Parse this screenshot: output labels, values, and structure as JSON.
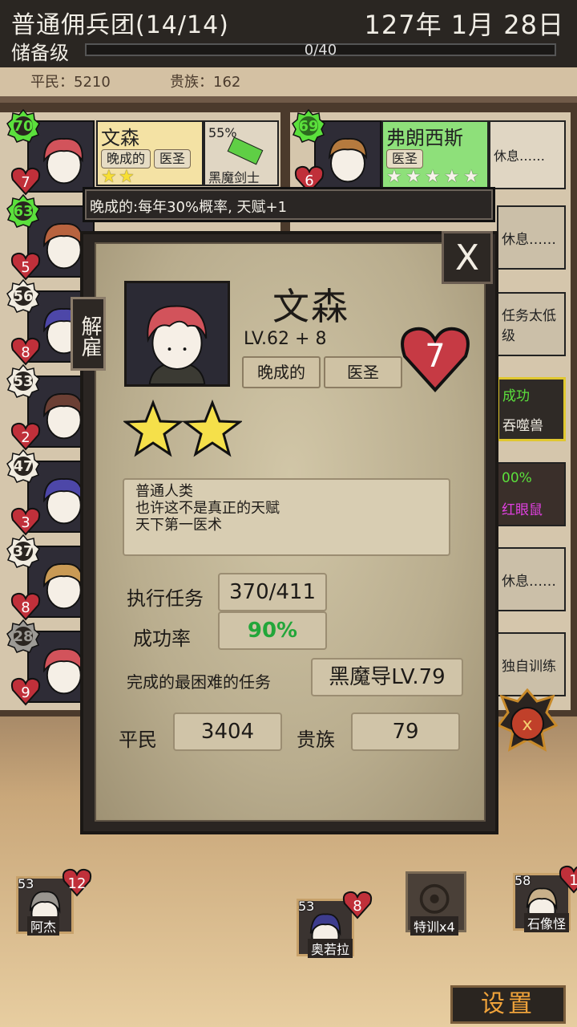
{
  "header": {
    "guild_name": "普通佣兵团(14/14)",
    "date": "127年 1月 28日",
    "rank": "储备级",
    "rep_text": "0/40",
    "rep_progress": 0
  },
  "counts": {
    "commoners": "平民：5210",
    "nobles": "贵族：162"
  },
  "mercs": [
    {
      "level": "70",
      "hearts": "7",
      "name": "文森",
      "tags": [
        "晚成的",
        "医圣"
      ],
      "stars": 2,
      "task_pct": "55%",
      "task_name": "黑魔剑士",
      "badge_color": "#5be03c"
    },
    {
      "level": "63",
      "hearts": "5",
      "badge_color": "#5be03c"
    },
    {
      "level": "56",
      "hearts": "8",
      "badge_color": "#f1ece0"
    },
    {
      "level": "53",
      "hearts": "2",
      "badge_color": "#f1ece0"
    },
    {
      "level": "47",
      "hearts": "3",
      "badge_color": "#f1ece0"
    },
    {
      "level": "37",
      "hearts": "8",
      "badge_color": "#f1ece0"
    },
    {
      "level": "28",
      "hearts": "9",
      "badge_color": "#9c9a95"
    }
  ],
  "right_merc": {
    "level": "69",
    "hearts": "6",
    "name": "弗朗西斯",
    "tag": "医圣",
    "stars": 5,
    "status": "休息……"
  },
  "right_slots": [
    "休息……",
    "任务太低级",
    "成功",
    "吞噬兽",
    "00%",
    "红眼鼠",
    "休息……",
    "独自训练"
  ],
  "trait_tip": "晚成的:每年30%概率, 天赋+1",
  "detail": {
    "close": "X",
    "fire": "解雇",
    "name": "文森",
    "level": "LV.62 + 8",
    "tags": [
      "晚成的",
      "医圣"
    ],
    "hearts": "7",
    "stars": 2,
    "description": [
      "普通人类",
      "也许这不是真正的天赋",
      "天下第一医术"
    ],
    "stats": {
      "tasks_label": "执行任务",
      "tasks_value": "370/411",
      "rate_label": "成功率",
      "rate_value": "90%",
      "hardest_label": "完成的最困难的任务",
      "hardest_value": "黑魔导LV.79",
      "commoners_label": "平民",
      "commoners_value": "3404",
      "nobles_label": "贵族",
      "nobles_value": "79"
    }
  },
  "bench": [
    {
      "level": "53",
      "hearts": "12",
      "name": "阿杰"
    },
    {
      "level": "53",
      "hearts": "8",
      "name": "奥若拉"
    },
    {
      "level": "58",
      "hearts": "1",
      "name": "石像怪"
    }
  ],
  "training": "特训x4",
  "settings": "设置"
}
